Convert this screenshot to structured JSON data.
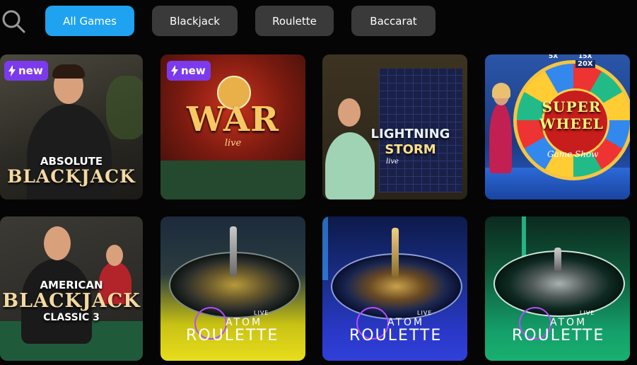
{
  "icons": {
    "search": "search-icon",
    "new_badge": "lightning-icon"
  },
  "filters": [
    {
      "label": "All Games",
      "active": true
    },
    {
      "label": "Blackjack",
      "active": false
    },
    {
      "label": "Roulette",
      "active": false
    },
    {
      "label": "Baccarat",
      "active": false
    }
  ],
  "colors": {
    "accent": "#1fa3f0",
    "chip": "#3a3a3a",
    "badge": "#7c3aed"
  },
  "badge_label": "new",
  "games": [
    {
      "line1": "ABSOLUTE",
      "line2": "BLACKJACK",
      "badge": true
    },
    {
      "line1": "WAR",
      "line2": "live",
      "badge": true
    },
    {
      "line1": "LIGHTNING",
      "line2": "STORM",
      "line3": "live",
      "badge": false
    },
    {
      "line1": "SUPER",
      "line2": "WHEEL",
      "line3": "Game Show",
      "extra1": "20X",
      "extra2": "15X",
      "extra3": "5X",
      "badge": false
    },
    {
      "line1": "AMERICAN",
      "line2": "BLACKJACK",
      "line3": "CLASSIC 3",
      "badge": false
    },
    {
      "live": "LIVE",
      "atom": "ATOM",
      "roulette": "ROULETTE",
      "badge": false
    },
    {
      "live": "LIVE",
      "atom": "ATOM",
      "roulette": "ROULETTE",
      "badge": false
    },
    {
      "live": "LIVE",
      "atom": "ATOM",
      "roulette": "ROULETTE",
      "badge": false
    }
  ]
}
